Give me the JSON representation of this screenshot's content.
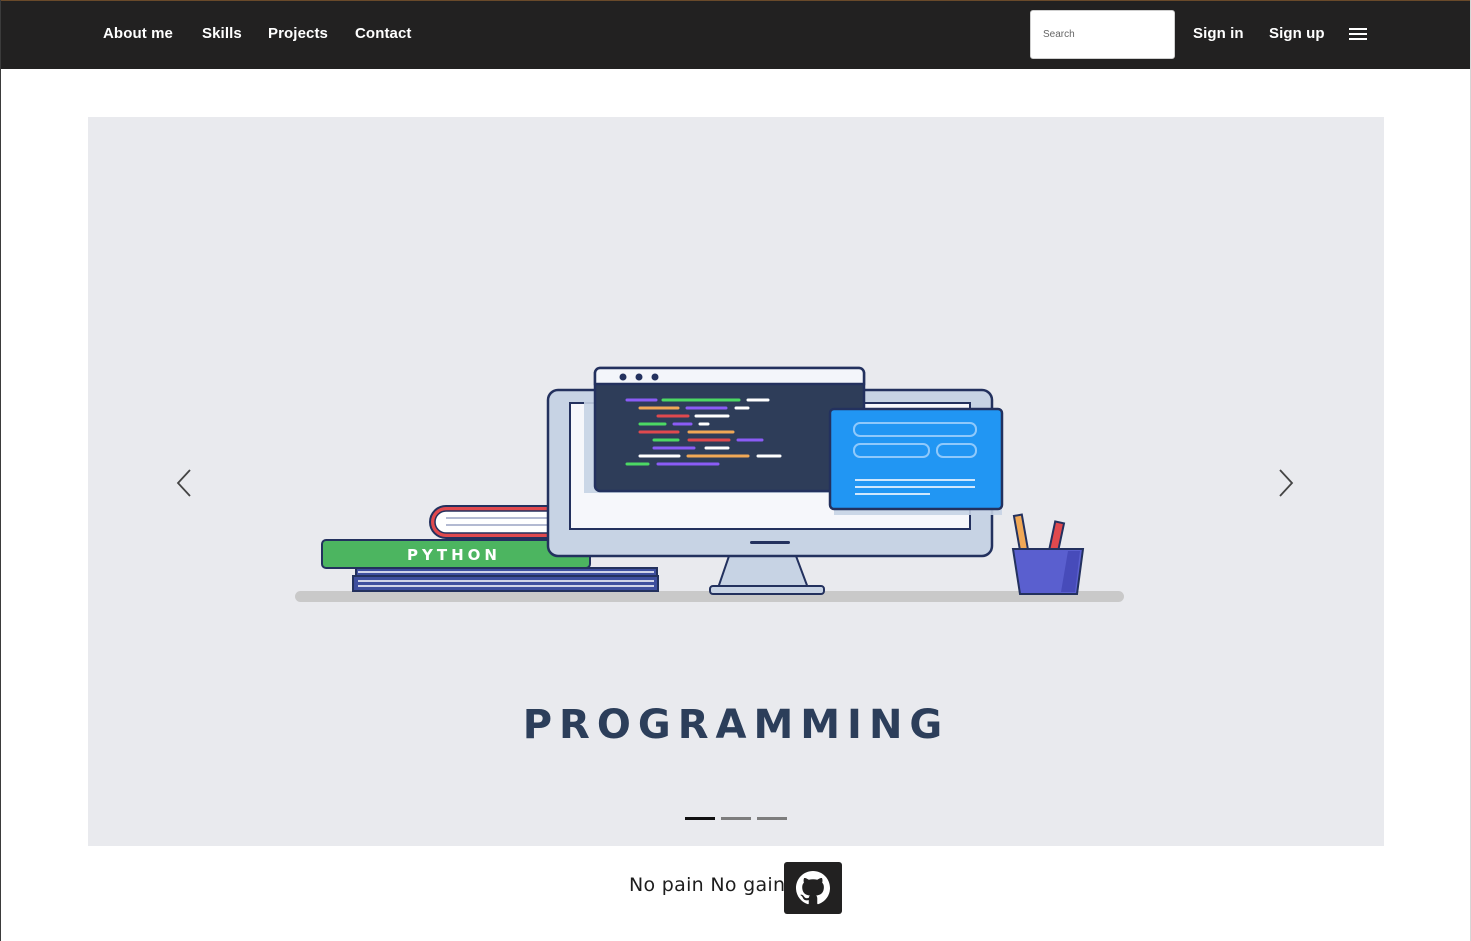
{
  "navbar": {
    "links": {
      "about": "About me",
      "skills": "Skills",
      "projects": "Projects",
      "contact": "Contact"
    },
    "search": {
      "placeholder": "Search",
      "value": ""
    },
    "sign_in": "Sign in",
    "sign_up": "Sign up",
    "menu_icon": "hamburger-menu-icon"
  },
  "carousel": {
    "slide_title": "PROGRAMMING",
    "book_label": "PYTHON",
    "prev_icon": "chevron-left-icon",
    "next_icon": "chevron-right-icon",
    "active_indicator": 0,
    "indicator_count": 3
  },
  "footer": {
    "motto": "No pain No gain",
    "github_icon": "github-icon"
  },
  "colors": {
    "navbar_bg": "#222121",
    "carousel_bg": "#e9eaee",
    "title_color": "#2c3e5a"
  }
}
